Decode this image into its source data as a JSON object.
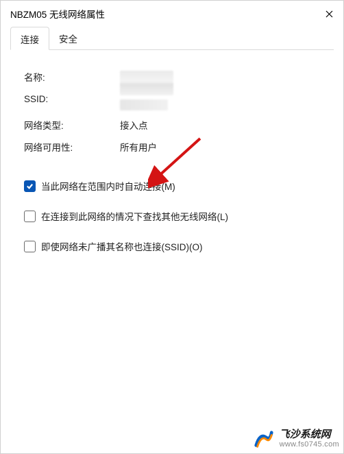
{
  "title": "NBZM05 无线网络属性",
  "tabs": {
    "connection": "连接",
    "security": "安全"
  },
  "info": {
    "name_label": "名称:",
    "ssid_label": "SSID:",
    "network_type_label": "网络类型:",
    "network_type_value": "接入点",
    "network_availability_label": "网络可用性:",
    "network_availability_value": "所有用户"
  },
  "checkboxes": {
    "auto_connect": "当此网络在范围内时自动连接(M)",
    "look_for_other": "在连接到此网络的情况下查找其他无线网络(L)",
    "connect_hidden": "即使网络未广播其名称也连接(SSID)(O)"
  },
  "watermark": {
    "title": "飞沙系统网",
    "url": "www.fs0745.com"
  }
}
